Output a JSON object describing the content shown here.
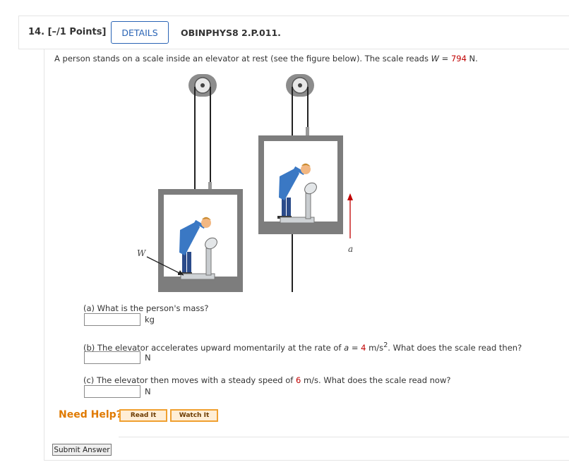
{
  "question": {
    "number": "14.",
    "points": "[–/1 Points]",
    "details_label": "DETAILS",
    "code": "OBINPHYS8 2.P.011."
  },
  "intro": {
    "text_before": "A person stands on a scale inside an elevator at rest (see the figure below). The scale reads ",
    "var": "W",
    "eq": " = ",
    "value": "794",
    "text_after": " N."
  },
  "figure": {
    "label_w": "W",
    "label_a": "a"
  },
  "parts": [
    {
      "label": "(a) What is the person's mass?",
      "input_value": "",
      "unit": "kg"
    },
    {
      "label_before": "(b) The elevator accelerates upward momentarily at the rate of ",
      "var": "a",
      "eq": " = ",
      "value": "4",
      "unit_text": " m/s",
      "sup": "2",
      "label_after": ". What does the scale read then?",
      "input_value": "",
      "unit": "N"
    },
    {
      "label_before": "(c) The elevator then moves with a steady speed of ",
      "value": "6",
      "label_after": " m/s. What does the scale read now?",
      "input_value": "",
      "unit": "N"
    }
  ],
  "help": {
    "need_help": "Need Help?",
    "read_it": "Read It",
    "watch_it": "Watch It"
  },
  "submit_label": "Submit Answer",
  "colors": {
    "accent_blue": "#2a64b5",
    "value_red": "#c00000",
    "help_orange": "#e07a00"
  }
}
